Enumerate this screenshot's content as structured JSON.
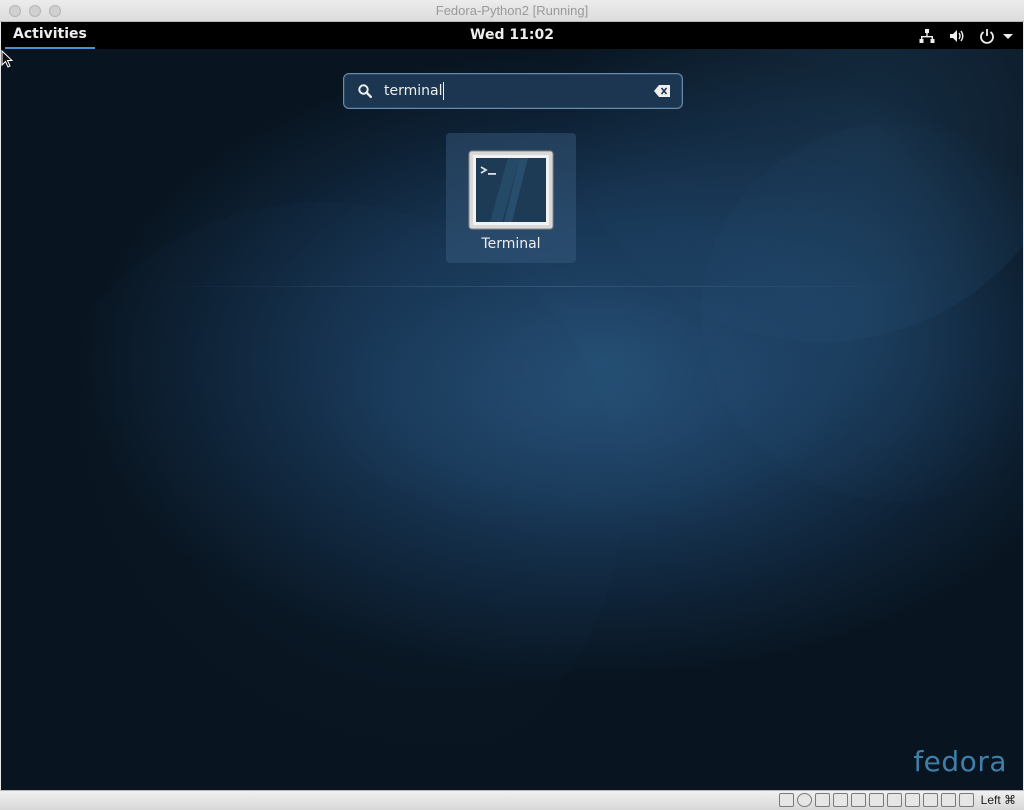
{
  "host_window": {
    "title": "Fedora-Python2 [Running]",
    "host_key": "Left ⌘"
  },
  "top_panel": {
    "activities_label": "Activities",
    "clock": "Wed 11:02",
    "tray_icons": [
      "network-icon",
      "volume-icon",
      "power-icon",
      "chevron-down-icon"
    ]
  },
  "search": {
    "value": "terminal"
  },
  "results": [
    {
      "label": "Terminal",
      "icon": "terminal-app-icon"
    }
  ],
  "branding": {
    "logo_text": "fedora"
  },
  "colors": {
    "panel": "#000000",
    "accent": "#4a90d9",
    "background": "#183756"
  }
}
